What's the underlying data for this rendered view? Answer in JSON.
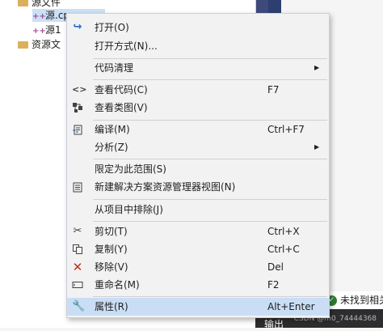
{
  "explorer": {
    "rows": [
      {
        "name": "源文件",
        "type": "folder"
      },
      {
        "name": "源.cpp",
        "type": "cpp",
        "selected": true
      },
      {
        "name": "源1",
        "type": "cpp"
      },
      {
        "name": "资源文",
        "type": "folder"
      }
    ]
  },
  "context_menu": {
    "items": [
      {
        "id": "open",
        "label": "打开(O)",
        "shortcut": "",
        "icon": "open-arrow-icon",
        "submenu": false
      },
      {
        "id": "open-with",
        "label": "打开方式(N)...",
        "shortcut": "",
        "icon": "",
        "submenu": false
      },
      {
        "id": "code-cleanup",
        "label": "代码清理",
        "shortcut": "",
        "icon": "",
        "submenu": true
      },
      {
        "id": "view-code",
        "label": "查看代码(C)",
        "shortcut": "F7",
        "icon": "code-brackets-icon",
        "submenu": false
      },
      {
        "id": "view-class-diagram",
        "label": "查看类图(V)",
        "shortcut": "",
        "icon": "class-diagram-icon",
        "submenu": false
      },
      {
        "id": "compile",
        "label": "编译(M)",
        "shortcut": "Ctrl+F7",
        "icon": "compile-icon",
        "submenu": false
      },
      {
        "id": "analyze",
        "label": "分析(Z)",
        "shortcut": "",
        "icon": "",
        "submenu": true
      },
      {
        "id": "scope-to-this",
        "label": "限定为此范围(S)",
        "shortcut": "",
        "icon": "",
        "submenu": false
      },
      {
        "id": "new-explorer-view",
        "label": "新建解决方案资源管理器视图(N)",
        "shortcut": "",
        "icon": "new-view-icon",
        "submenu": false
      },
      {
        "id": "exclude",
        "label": "从项目中排除(J)",
        "shortcut": "",
        "icon": "",
        "submenu": false
      },
      {
        "id": "cut",
        "label": "剪切(T)",
        "shortcut": "Ctrl+X",
        "icon": "scissors-icon",
        "submenu": false
      },
      {
        "id": "copy",
        "label": "复制(Y)",
        "shortcut": "Ctrl+C",
        "icon": "copy-icon",
        "submenu": false
      },
      {
        "id": "remove",
        "label": "移除(V)",
        "shortcut": "Del",
        "icon": "remove-x-icon",
        "submenu": false
      },
      {
        "id": "rename",
        "label": "重命名(M)",
        "shortcut": "F2",
        "icon": "rename-icon",
        "submenu": false
      },
      {
        "id": "properties",
        "label": "属性(R)",
        "shortcut": "Alt+Enter",
        "icon": "wrench-icon",
        "submenu": false,
        "highlighted": true
      }
    ]
  },
  "status": {
    "issues_text": "未找到相关",
    "output_tab": "输出",
    "watermark": "CSDN @m0_74444368"
  },
  "colors": {
    "menu_bg": "#f2f2f2",
    "highlight": "#c9def5",
    "remove_icon": "#c42b1c",
    "open_icon": "#1e6fc4",
    "vs_blue": "#2c3f70"
  }
}
